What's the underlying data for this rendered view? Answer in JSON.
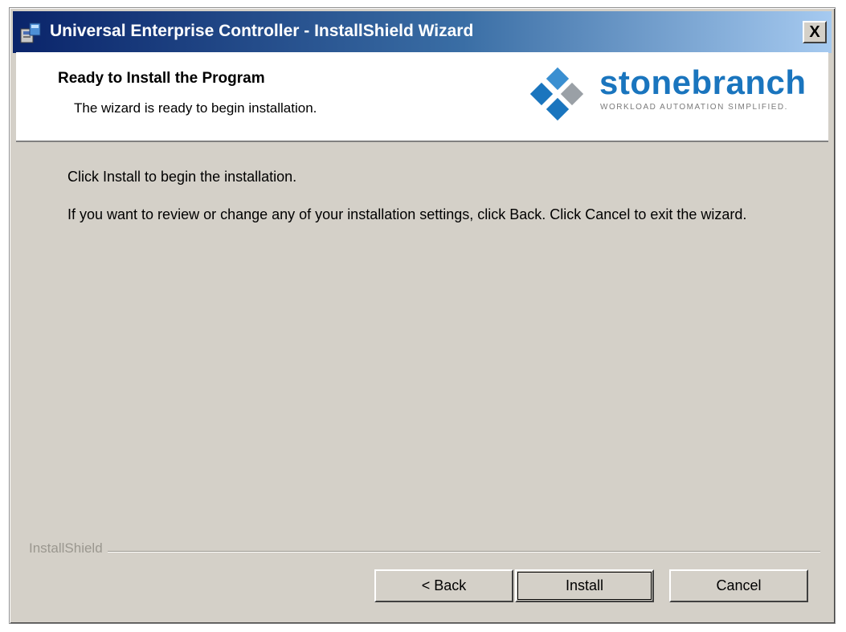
{
  "window": {
    "title": "Universal Enterprise Controller - InstallShield Wizard",
    "close_label": "X"
  },
  "header": {
    "title": "Ready to Install the Program",
    "subtitle": "The wizard is ready to begin installation.",
    "logo_name": "stonebranch",
    "logo_tagline": "WORKLOAD AUTOMATION SIMPLIFIED.",
    "logo_colors": [
      "#1a75be",
      "#9aa0a6"
    ]
  },
  "body": {
    "line1": "Click Install to begin the installation.",
    "line2": "If you want to review or change any of your installation settings, click Back. Click Cancel to exit the wizard."
  },
  "footer": {
    "brand": "InstallShield",
    "buttons": {
      "back": "< Back",
      "install": "Install",
      "cancel": "Cancel"
    }
  },
  "icons": [
    "installer-app-icon",
    "close-icon",
    "stonebranch-logo-icon"
  ]
}
